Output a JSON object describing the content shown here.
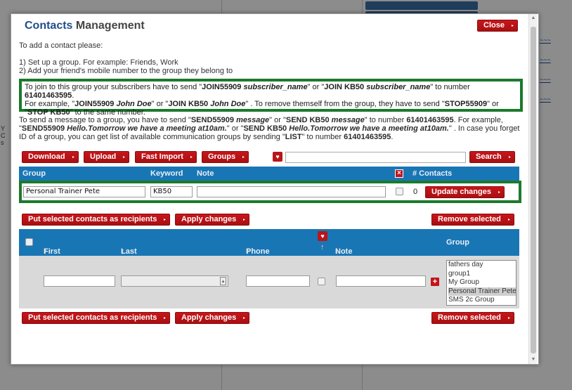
{
  "modal": {
    "title_accent": "Contacts",
    "title_rest": "Management",
    "close_label": "Close",
    "intro": "To add a contact please:",
    "step1": "1) Set up a group. For example: Friends, Work",
    "step2": "2) Add your friend's mobile number to the group they belong to"
  },
  "info_box": {
    "t1": "To join to this group your subscribers have to send \"",
    "join_code": "JOIN55909",
    "subscriber_name": "subscriber_name",
    "t2": "\" or \"",
    "join_kw": "JOIN KB50",
    "t3": "\" to number ",
    "number": "61401463595",
    "t4": ".",
    "t5": "For example, \"",
    "ex1_code": "JOIN55909",
    "ex_name": "John Doe",
    "t6": "\" or \"",
    "ex2_kw": "JOIN KB50",
    "t7": "\" . To remove themself from the group, they have to send \"",
    "stop_code": "STOP55909",
    "t8": "\" or \"",
    "stop_kw": "STOP KB50",
    "t9": "\" to the same number."
  },
  "send_info": {
    "s1": "To send a message to a group, you have to send \"",
    "send_code": "SEND55909",
    "message": "message",
    "s2": "\" or \"",
    "send_kw": "SEND KB50",
    "s3": "\" to number ",
    "number": "61401463595",
    "s4": ". For example, \"",
    "ex_code": "SEND55909",
    "ex_msg": "Hello.Tomorrow we have a meeting at10am.",
    "s5": "\" or \"",
    "ex_kw": "SEND KB50",
    "s6": "\" . In case you forget ID of a group, you can get list of available communication groups by sending \"",
    "list_kw": "LIST",
    "s7": "\" to number ",
    "s8": "."
  },
  "toolbar": {
    "download": "Download",
    "upload": "Upload",
    "fast_import": "Fast Import",
    "groups": "Groups",
    "search": "Search"
  },
  "group_table": {
    "headers": {
      "group": "Group",
      "keyword": "Keyword",
      "note": "Note",
      "contacts": "# Contacts"
    },
    "row": {
      "group": "Personal Trainer Pete",
      "keyword": "KB50",
      "note": "",
      "count": "0",
      "update_label": "Update changes"
    }
  },
  "actions": {
    "put_selected": "Put selected contacts as recipients",
    "apply": "Apply changes",
    "remove": "Remove selected"
  },
  "contacts_table": {
    "headers": {
      "first_name": "First Name",
      "last_name": "Last Name",
      "phone": "Phone",
      "note": "Note",
      "group": "Group"
    },
    "sort_arrow": "↑",
    "groups": [
      "fathers day",
      "group1",
      "My Group",
      "Personal Trainer Pete",
      "SMS 2c Group"
    ],
    "selected_group": "Personal Trainer Pete"
  },
  "colors": {
    "header_blue": "#1976b5",
    "button_red": "#b8161a",
    "highlight_green": "#1c7a2c",
    "title_blue": "#1f4e8c"
  }
}
